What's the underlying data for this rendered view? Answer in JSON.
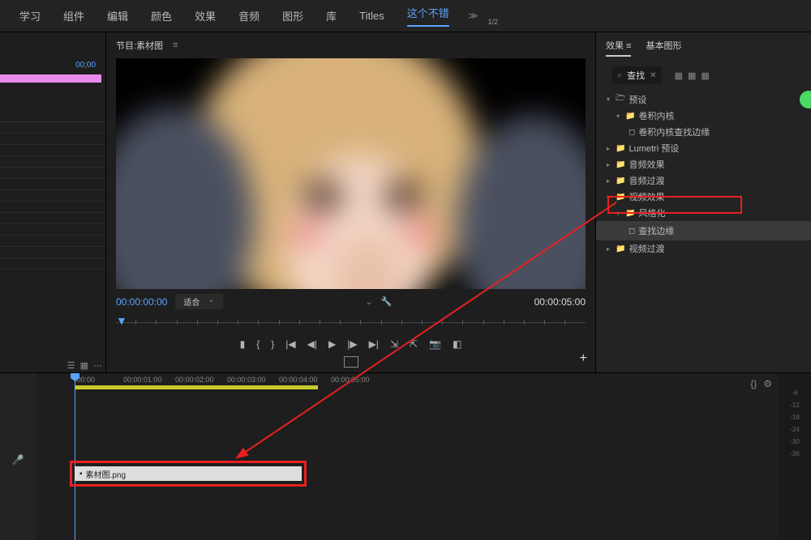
{
  "tabs": [
    "学习",
    "组件",
    "编辑",
    "颜色",
    "效果",
    "音频",
    "图形",
    "库",
    "Titles",
    "这个不错"
  ],
  "active_tab": 9,
  "program_title": "节目:素材图",
  "left_timecode": "00;00",
  "timecode_left": "00:00:00:00",
  "fit_label": "适合",
  "half_label": "1/2",
  "timecode_right": "00:00:05:00",
  "right_tabs": {
    "effects": "效果",
    "basic": "基本图形"
  },
  "search_term": "查找",
  "tree": {
    "presets": "预设",
    "conv_kernel": "卷积内核",
    "conv_find_edges": "卷积内核查找边缘",
    "lumetri": "Lumetri 预设",
    "audio_fx": "音频效果",
    "audio_trans": "音频过渡",
    "video_fx": "视频效果",
    "stylize": "风格化",
    "find_edges": "查找边缘",
    "video_trans": "视频过渡"
  },
  "clip_name": "素材图.png",
  "timeline_marks": [
    ":00:00",
    "00:00:01:00",
    "00:00:02:00",
    "00:00:03:00",
    "00:00:04:00",
    "00:00:05:00"
  ],
  "db_marks": [
    "-6",
    "-12",
    "-18",
    "-24",
    "-30",
    "-36"
  ]
}
